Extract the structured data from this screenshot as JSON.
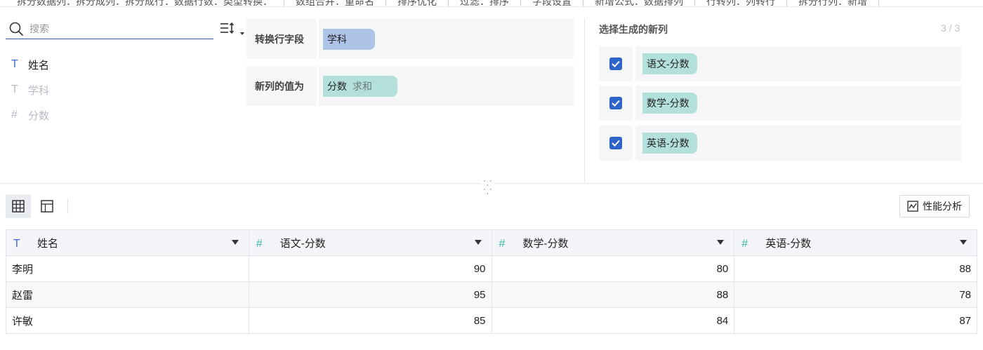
{
  "top_tabs": [
    "拆分数据列：拆分成列：拆分成行：数据行数：类型转换：",
    "数组合并：重命名",
    "排序优化",
    "过滤：排序",
    "字段设置",
    "新增公式：数据排列",
    "行转列：列转行",
    "拆分行列：新增"
  ],
  "search": {
    "placeholder": "搜索"
  },
  "fields": [
    {
      "icon": "text-type-icon",
      "glyph": "T",
      "label": "姓名",
      "state": "active"
    },
    {
      "icon": "text-type-icon",
      "glyph": "T",
      "label": "学科",
      "state": "disabled"
    },
    {
      "icon": "number-type-icon",
      "glyph": "#",
      "label": "分数",
      "state": "disabled"
    }
  ],
  "config": {
    "row_field_label": "转换行字段",
    "row_field_value": "学科",
    "value_label": "新列的值为",
    "value_field": "分数",
    "value_agg": "求和"
  },
  "new_columns": {
    "title": "选择生成的新列",
    "count": "3 / 3",
    "items": [
      {
        "label": "语文-分数",
        "checked": true
      },
      {
        "label": "数学-分数",
        "checked": true
      },
      {
        "label": "英语-分数",
        "checked": true
      }
    ]
  },
  "toolbar": {
    "perf_label": "性能分析"
  },
  "table": {
    "columns": [
      {
        "label": "姓名",
        "type": "text"
      },
      {
        "label": "语文-分数",
        "type": "number"
      },
      {
        "label": "数学-分数",
        "type": "number"
      },
      {
        "label": "英语-分数",
        "type": "number"
      }
    ],
    "rows": [
      [
        "李明",
        "90",
        "80",
        "88"
      ],
      [
        "赵雷",
        "95",
        "88",
        "78"
      ],
      [
        "许敏",
        "85",
        "84",
        "87"
      ]
    ]
  },
  "colors": {
    "accent": "#2e63c9",
    "row_field_pill": "#aec3e8",
    "value_pill": "#b3e0da"
  }
}
